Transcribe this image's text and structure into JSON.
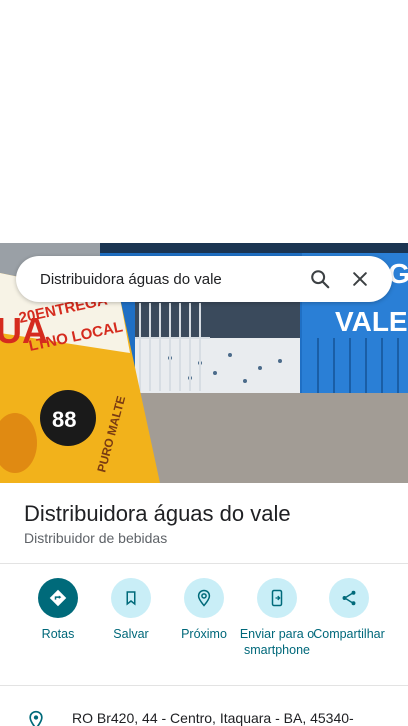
{
  "search": {
    "query": "Distribuidora águas do vale",
    "search_icon": "search-icon",
    "close_icon": "close-icon"
  },
  "photo": {
    "sign_left_1": "20ENTREGA",
    "sign_left_2": "LTNO LOCAL",
    "sign_left_big": "UA",
    "sign_price": "88",
    "sign_brand": "PURO MALTE",
    "wall_right_1": "AGU",
    "wall_right_2": "VALE"
  },
  "place": {
    "title": "Distribuidora águas do vale",
    "category": "Distribuidor de bebidas"
  },
  "actions": [
    {
      "label": "Rotas",
      "icon": "directions-icon"
    },
    {
      "label": "Salvar",
      "icon": "bookmark-icon"
    },
    {
      "label": "Próximo",
      "icon": "nearby-icon"
    },
    {
      "label": "Enviar para o smartphone",
      "icon": "send-to-phone-icon"
    },
    {
      "label": "Compartilhar",
      "icon": "share-icon"
    }
  ],
  "address": {
    "text": "RO Br420, 44 - Centro, Itaquara - BA, 45340-",
    "icon": "location-pin-icon"
  },
  "colors": {
    "accent": "#006a7a",
    "accent_light": "#c9eef7",
    "label": "#00687a",
    "wall_blue": "#1f6fc4"
  }
}
